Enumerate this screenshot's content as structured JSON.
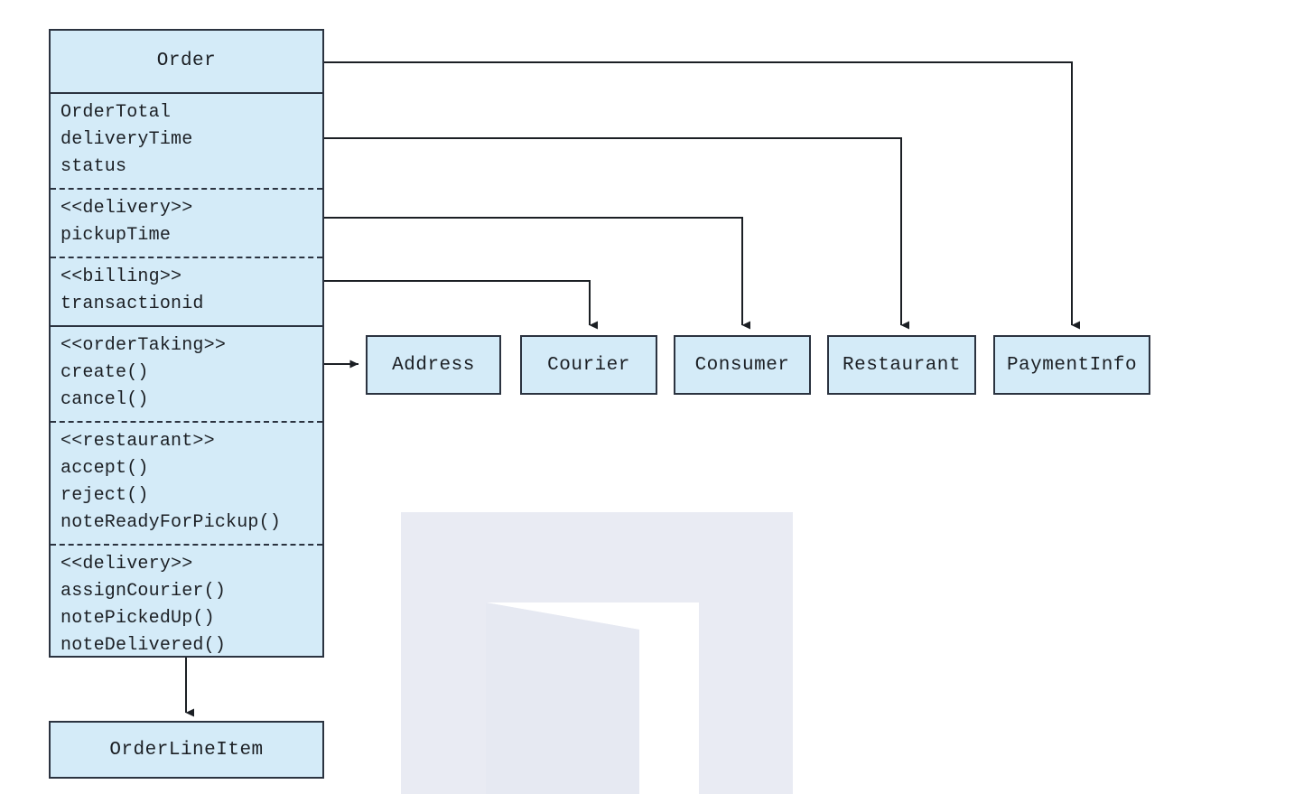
{
  "diagram": {
    "type": "uml-class-diagram",
    "background_color": "#ffffff",
    "box_fill_color": "#d4ebf8",
    "box_border_color": "#2b3340",
    "connector_color": "#1b1f24"
  },
  "main_class": {
    "name": "Order",
    "attribute_compartments": [
      {
        "stereotype": null,
        "members": [
          "OrderTotal",
          "deliveryTime",
          "status"
        ]
      },
      {
        "stereotype": "<<delivery>>",
        "members": [
          "pickupTime"
        ]
      },
      {
        "stereotype": "<<billing>>",
        "members": [
          "transactionid"
        ]
      }
    ],
    "operation_compartments": [
      {
        "stereotype": "<<orderTaking>>",
        "members": [
          "create()",
          "cancel()"
        ]
      },
      {
        "stereotype": "<<restaurant>>",
        "members": [
          "accept()",
          "reject()",
          "noteReadyForPickup()"
        ]
      },
      {
        "stereotype": "<<delivery>>",
        "members": [
          "assignCourier()",
          "notePickedUp()",
          "noteDelivered()"
        ]
      }
    ]
  },
  "related_classes": [
    {
      "name": "Address"
    },
    {
      "name": "Courier"
    },
    {
      "name": "Consumer"
    },
    {
      "name": "Restaurant"
    },
    {
      "name": "PaymentInfo"
    }
  ],
  "child_class": {
    "name": "OrderLineItem"
  }
}
